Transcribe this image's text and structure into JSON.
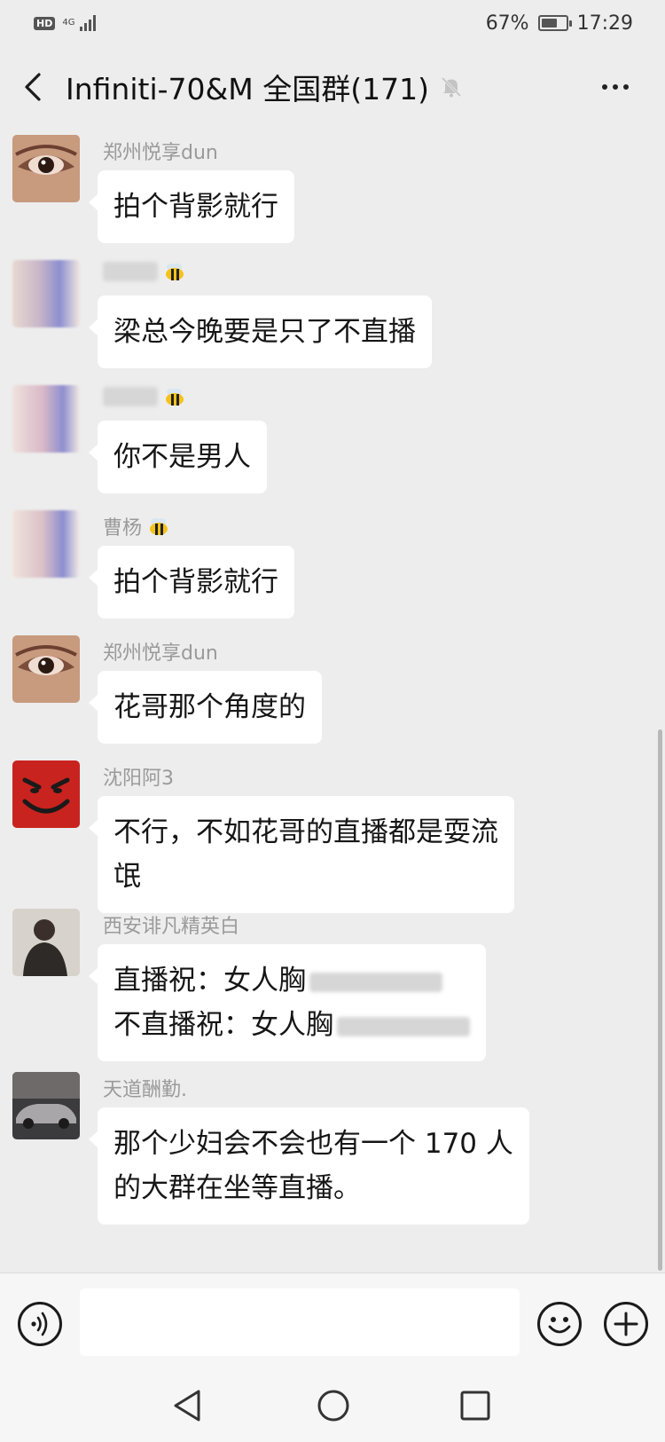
{
  "status_bar": {
    "hd": "HD",
    "network": "4G",
    "battery": "67%",
    "battery_level": 0.67,
    "time": "17:29"
  },
  "header": {
    "title": "Infiniti-70&M 全国群(171)",
    "back_icon": "chevron-left-icon",
    "mute_icon": "bell-muted-icon",
    "more_icon": "more-horizontal-icon"
  },
  "messages": [
    {
      "sender": "郑州悦享dun",
      "lines": [
        "拍个背影就行"
      ]
    },
    {
      "sender": "",
      "lines": [
        "梁总今晚要是只了不直播"
      ]
    },
    {
      "sender": "",
      "lines": [
        "你不是男人"
      ]
    },
    {
      "sender": "曹杨",
      "lines": [
        "拍个背影就行"
      ]
    },
    {
      "sender": "郑州悦享dun",
      "lines": [
        "花哥那个角度的"
      ]
    },
    {
      "sender": "沈阳阿3",
      "lines": [
        "不行，不如花哥的直播都是耍流",
        "氓"
      ]
    },
    {
      "sender": "西安诽凡精英白",
      "lines": [
        "直播祝：女人胸",
        "不直播祝：女人胸"
      ]
    },
    {
      "sender": "天道酬勤.",
      "lines": [
        "那个少妇会不会也有一个 170 人",
        "的大群在坐等直播。"
      ]
    }
  ],
  "input_bar": {
    "voice_icon": "voice-icon",
    "input_value": "",
    "emoji_icon": "emoji-icon",
    "plus_icon": "plus-icon"
  },
  "nav_bar": {
    "back_icon": "triangle-back-icon",
    "home_icon": "circle-home-icon",
    "recent_icon": "square-recent-icon"
  },
  "colors": {
    "background": "#ededed",
    "bubble": "#ffffff",
    "sender_text": "#9a9a9a",
    "bar": "#f6f6f6"
  }
}
